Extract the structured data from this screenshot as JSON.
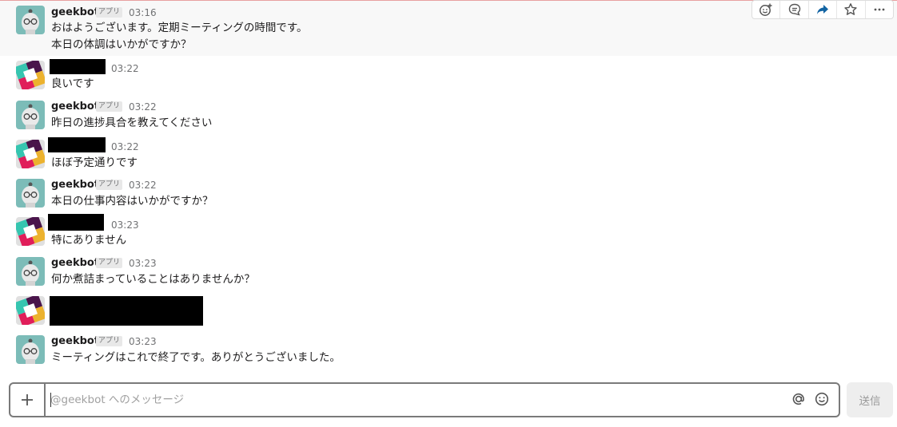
{
  "messages": [
    {
      "type": "bot",
      "author": "geekbot",
      "badge": "アプリ",
      "time": "03:16",
      "lines": [
        "おはようございます。定期ミーティングの時間です。",
        "本日の体調はいかがですか？"
      ]
    },
    {
      "type": "user",
      "time": "03:22",
      "lines": [
        "良いです"
      ]
    },
    {
      "type": "bot",
      "author": "geekbot",
      "badge": "アプリ",
      "time": "03:22",
      "lines": [
        "昨日の進捗具合を教えてください"
      ]
    },
    {
      "type": "user",
      "time": "03:22",
      "lines": [
        "ほぼ予定通りです"
      ]
    },
    {
      "type": "bot",
      "author": "geekbot",
      "badge": "アプリ",
      "time": "03:22",
      "lines": [
        "本日の仕事内容はいかがですか？"
      ]
    },
    {
      "type": "user",
      "time": "03:23",
      "lines": [
        "特にありません"
      ]
    },
    {
      "type": "bot",
      "author": "geekbot",
      "badge": "アプリ",
      "time": "03:23",
      "lines": [
        "何か煮詰まっていることはありませんか？"
      ]
    },
    {
      "type": "user",
      "time": "",
      "lines": []
    },
    {
      "type": "bot",
      "author": "geekbot",
      "badge": "アプリ",
      "time": "03:23",
      "lines": [
        "ミーティングはこれで終了です。ありがとうございました。"
      ]
    }
  ],
  "actions": [
    "add-reaction-icon",
    "start-thread-icon",
    "share-message-icon",
    "star-icon",
    "more-actions-icon"
  ],
  "composer": {
    "placeholder": "@geekbot へのメッセージ",
    "value": "",
    "send_label": "送信"
  },
  "colors": {
    "bot_avatar_bg": "#7cbcb8",
    "hover_bg": "#f8f8f8",
    "share_icon": "#1264a3"
  }
}
